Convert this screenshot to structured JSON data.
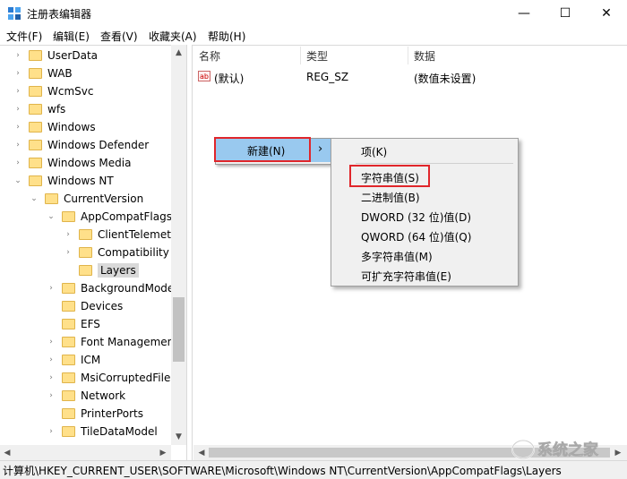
{
  "window": {
    "title": "注册表编辑器",
    "controls": {
      "minimize": "—",
      "maximize": "☐",
      "close": "✕"
    }
  },
  "menubar": [
    "文件(F)",
    "编辑(E)",
    "查看(V)",
    "收藏夹(A)",
    "帮助(H)"
  ],
  "tree": [
    {
      "label": "UserData",
      "arrow": "›"
    },
    {
      "label": "WAB",
      "arrow": "›"
    },
    {
      "label": "WcmSvc",
      "arrow": "›"
    },
    {
      "label": "wfs",
      "arrow": "›"
    },
    {
      "label": "Windows",
      "arrow": "›"
    },
    {
      "label": "Windows Defender",
      "arrow": "›"
    },
    {
      "label": "Windows Media",
      "arrow": "›"
    },
    {
      "label": "Windows NT",
      "arrow": "⌄"
    },
    {
      "label": "CurrentVersion",
      "arrow": "⌄"
    },
    {
      "label": "AppCompatFlags",
      "arrow": "⌄"
    },
    {
      "label": "ClientTelemetr",
      "arrow": "›"
    },
    {
      "label": "Compatibility A",
      "arrow": "›"
    },
    {
      "label": "Layers",
      "arrow": ""
    },
    {
      "label": "BackgroundMode",
      "arrow": "›"
    },
    {
      "label": "Devices",
      "arrow": ""
    },
    {
      "label": "EFS",
      "arrow": ""
    },
    {
      "label": "Font Managemen",
      "arrow": "›"
    },
    {
      "label": "ICM",
      "arrow": "›"
    },
    {
      "label": "MsiCorruptedFile",
      "arrow": "›"
    },
    {
      "label": "Network",
      "arrow": "›"
    },
    {
      "label": "PrinterPorts",
      "arrow": ""
    },
    {
      "label": "TileDataModel",
      "arrow": "›"
    }
  ],
  "list": {
    "columns": [
      "名称",
      "类型",
      "数据"
    ],
    "rows": [
      {
        "name": "(默认)",
        "type": "REG_SZ",
        "data": "(数值未设置)",
        "icon": "ab"
      }
    ]
  },
  "context_menu": {
    "new_label": "新建(N)",
    "arrow": "›",
    "submenu": [
      "项(K)",
      "字符串值(S)",
      "二进制值(B)",
      "DWORD (32 位)值(D)",
      "QWORD (64 位)值(Q)",
      "多字符串值(M)",
      "可扩充字符串值(E)"
    ]
  },
  "statusbar": "计算机\\HKEY_CURRENT_USER\\SOFTWARE\\Microsoft\\Windows NT\\CurrentVersion\\AppCompatFlags\\Layers",
  "watermark": "系统之家",
  "colors": {
    "highlight_red": "#e0262b",
    "menu_hover": "#99c9ef",
    "folder": "#ffe08a"
  }
}
